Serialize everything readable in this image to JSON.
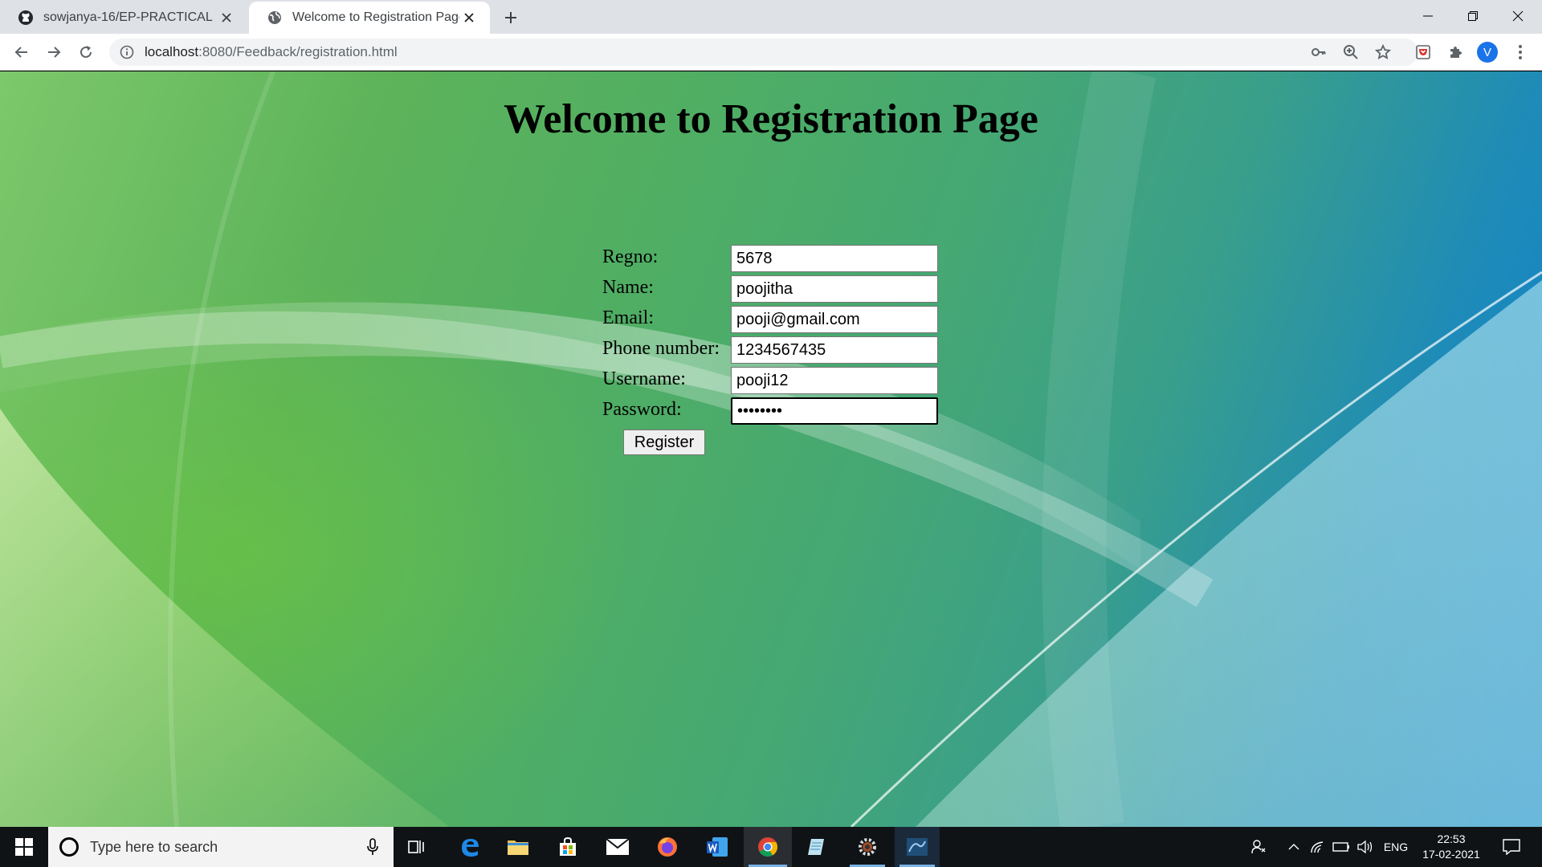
{
  "browser": {
    "tabs": [
      {
        "title": "sowjanya-16/EP-PRACTICAL",
        "favicon": "github-icon",
        "active": false
      },
      {
        "title": "Welcome to Registration Page",
        "favicon": "globe-icon",
        "active": true
      }
    ],
    "url": {
      "host": "localhost",
      "path": ":8080/Feedback/registration.html"
    },
    "profile_initial": "V"
  },
  "page": {
    "title": "Welcome to Registration Page",
    "fields": [
      {
        "label": "Regno:",
        "value": "5678",
        "type": "text"
      },
      {
        "label": "Name:",
        "value": "poojitha",
        "type": "text"
      },
      {
        "label": "Email:",
        "value": "pooji@gmail.com",
        "type": "text"
      },
      {
        "label": "Phone number:",
        "value": "1234567435",
        "type": "text"
      },
      {
        "label": "Username:",
        "value": "pooji12",
        "type": "text"
      },
      {
        "label": "Password:",
        "value": "••••••••",
        "type": "password"
      }
    ],
    "register_label": "Register"
  },
  "taskbar": {
    "search_placeholder": "Type here to search",
    "language": "ENG",
    "time": "22:53",
    "date": "17-02-2021"
  },
  "colors": {
    "accent_blue": "#1a73e8",
    "taskbar": "#101316",
    "tab_strip": "#dee1e6"
  }
}
